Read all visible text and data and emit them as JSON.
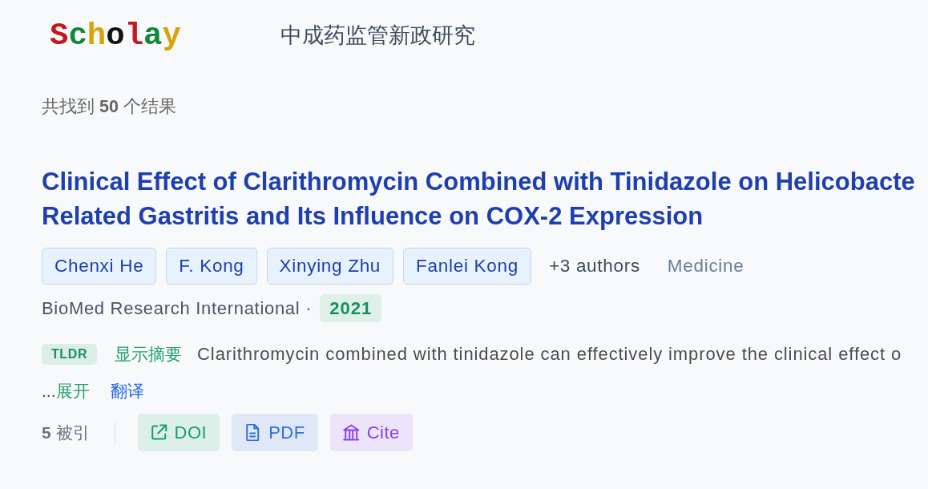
{
  "header": {
    "logo": {
      "letters": [
        {
          "char": "S",
          "color": "#c4171f"
        },
        {
          "char": "c",
          "color": "#13873b"
        },
        {
          "char": "h",
          "color": "#d8a20a"
        },
        {
          "char": "o",
          "color": "#111111"
        },
        {
          "char": "l",
          "color": "#c4171f"
        },
        {
          "char": "a",
          "color": "#13873b"
        },
        {
          "char": "y",
          "color": "#d8a20a"
        }
      ]
    },
    "query": "中成药监管新政研究"
  },
  "result_count": "共找到 **50** 个结果",
  "results": [
    {
      "title_lines": [
        "Clinical Effect of Clarithromycin Combined with Tinidazole on Helicobacte",
        "Related Gastritis and Its Influence on COX-2 Expression"
      ],
      "authors": [
        "Chenxi He",
        "F. Kong",
        "Xinying Zhu",
        "Fanlei Kong"
      ],
      "more_authors": "+3 authors",
      "field": "Medicine",
      "venue": "BioMed Research International ·",
      "year": "2021",
      "tldr": {
        "badge": "TLDR",
        "show_abstract": "显示摘要",
        "text": "Clarithromycin combined with tinidazole can effectively improve the clinical effect o"
      },
      "ellipsis": "...",
      "expand": "展开",
      "translate": "翻译",
      "citations": "**5** 被引",
      "actions": [
        {
          "kind": "doi",
          "label": "DOI"
        },
        {
          "kind": "pdf",
          "label": "PDF"
        },
        {
          "kind": "cite",
          "label": "Cite"
        }
      ]
    }
  ]
}
